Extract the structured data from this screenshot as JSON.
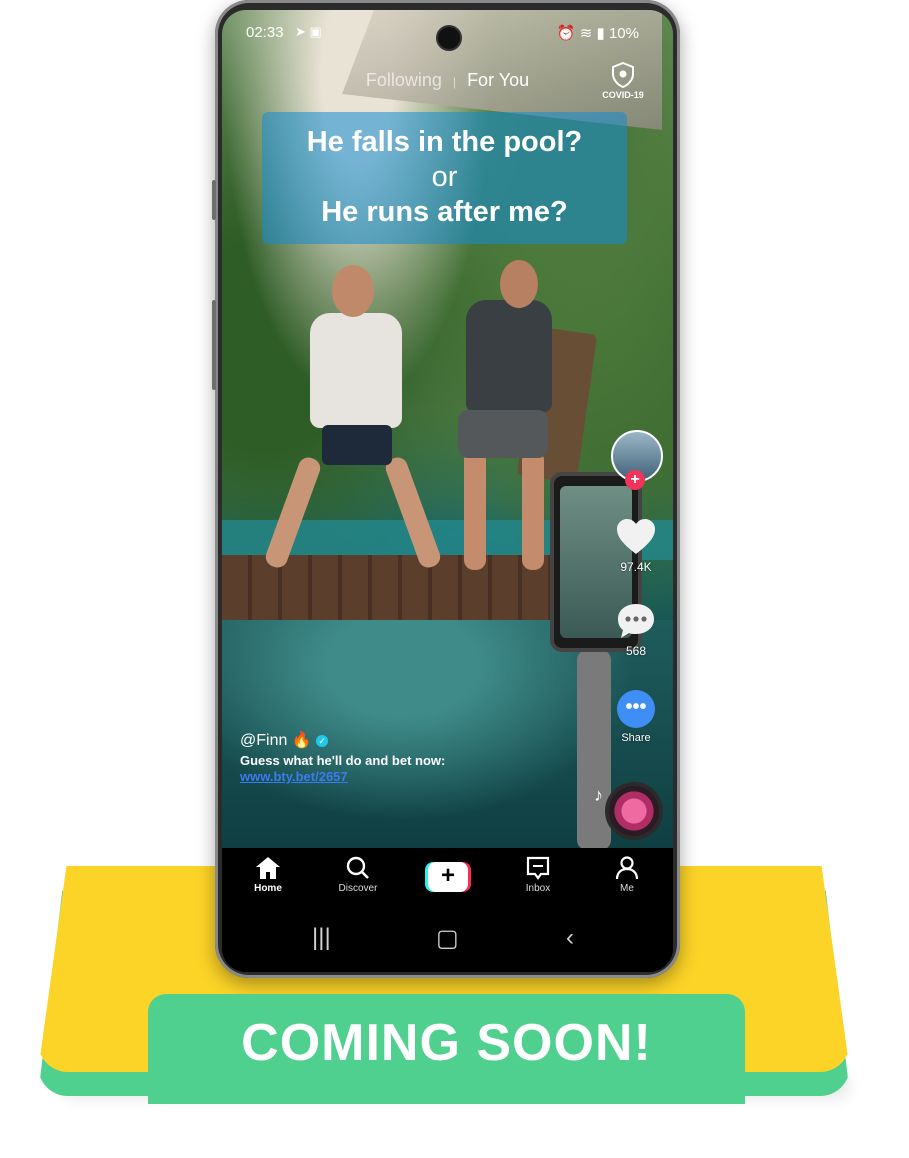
{
  "status_bar": {
    "time": "02:33",
    "battery": "10%"
  },
  "top_tabs": {
    "following": "Following",
    "for_you": "For You",
    "covid_label": "COVID-19"
  },
  "caption": {
    "line1": "He falls in the pool?",
    "line2": "or",
    "line3": "He runs after me?"
  },
  "rail": {
    "likes": "97.4K",
    "comments": "568",
    "share": "Share"
  },
  "post": {
    "username": "@Finn",
    "description": "Guess what he'll do and bet now:",
    "link": "www.bty.bet/2657"
  },
  "bottom_nav": {
    "home": "Home",
    "discover": "Discover",
    "inbox": "Inbox",
    "me": "Me"
  },
  "banner": {
    "text": "COMING SOON!"
  },
  "colors": {
    "yellow": "#fcd327",
    "green": "#4fd08f",
    "tiktok_red": "#fe2c55",
    "tiktok_cyan": "#25f4ee",
    "share_blue": "#3f8ef5"
  }
}
